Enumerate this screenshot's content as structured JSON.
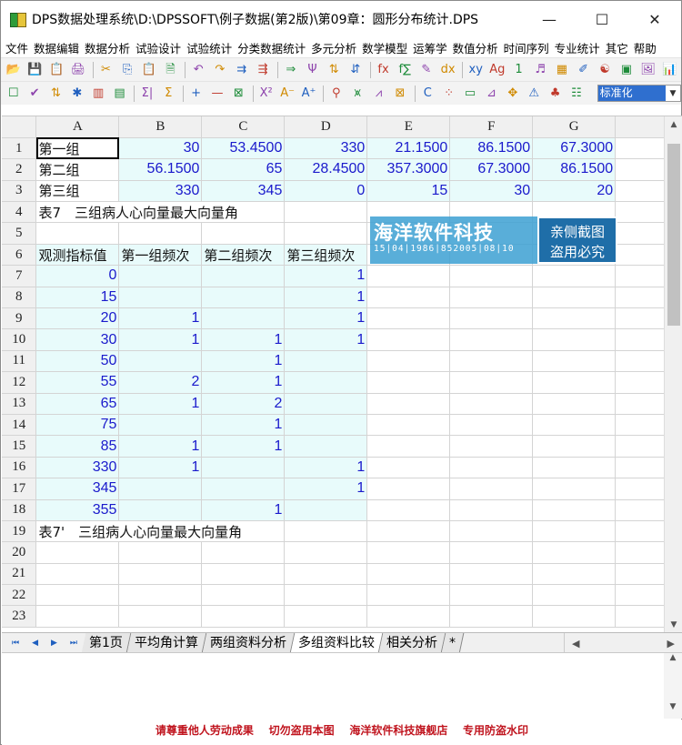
{
  "window": {
    "title": "DPS数据处理系统\\D:\\DPSSOFT\\例子数据(第2版)\\第09章：圆形分布统计.DPS",
    "min": "—",
    "max": "☐",
    "close": "✕"
  },
  "menu": [
    "文件",
    "数据编辑",
    "数据分析",
    "试验设计",
    "试验统计",
    "分类数据统计",
    "多元分析",
    "数学模型",
    "运筹学",
    "数值分析",
    "时间序列",
    "专业统计",
    "其它",
    "帮助"
  ],
  "toolbar1": [
    "📂",
    "💾",
    "📋",
    "🖨",
    "✂",
    "⎘",
    "📋",
    "🗎",
    "↶",
    "↷",
    "⇉",
    "⇶",
    "⇒",
    "Ψ",
    "⇅",
    "⇵",
    "fx",
    "f∑",
    "✎",
    "dx",
    "xy",
    "Ag",
    "1",
    "♬",
    "▦",
    "✐",
    "☯",
    "▣",
    "🖼",
    "📊"
  ],
  "toolbar2": [
    "☐",
    "✔",
    "⇅",
    "✱",
    "▥",
    "▤",
    "Σ|",
    "Σ",
    "+",
    "—",
    "⊠",
    "X²",
    "A⁻",
    "A⁺",
    "⚲",
    "⩙",
    "⩘",
    "⊠",
    "C",
    "⁘",
    "▭",
    "⊿",
    "✥",
    "⚠",
    "♣",
    "☷"
  ],
  "style_select": {
    "value": "标准化",
    "arrow": "▼"
  },
  "columns": [
    "A",
    "B",
    "C",
    "D",
    "E",
    "F",
    "G"
  ],
  "rows": [
    {
      "n": "1",
      "cells": [
        "第一组",
        "30",
        "53.4500",
        "330",
        "21.1500",
        "86.1500",
        "67.3000"
      ]
    },
    {
      "n": "2",
      "cells": [
        "第二组",
        "56.1500",
        "65",
        "28.4500",
        "357.3000",
        "67.3000",
        "86.1500"
      ]
    },
    {
      "n": "3",
      "cells": [
        "第三组",
        "330",
        "345",
        "0",
        "15",
        "30",
        "20"
      ]
    },
    {
      "n": "4",
      "cells": [
        "表7　三组病人心向量最大向量角",
        "",
        "",
        "",
        "",
        "",
        ""
      ]
    },
    {
      "n": "5",
      "cells": [
        "",
        "",
        "",
        "",
        "",
        "",
        ""
      ]
    },
    {
      "n": "6",
      "cells": [
        "观测指标值",
        "第一组频次",
        "第二组频次",
        "第三组频次",
        "",
        "",
        ""
      ]
    },
    {
      "n": "7",
      "cells": [
        "0",
        "",
        "",
        "1",
        "",
        "",
        ""
      ]
    },
    {
      "n": "8",
      "cells": [
        "15",
        "",
        "",
        "1",
        "",
        "",
        ""
      ]
    },
    {
      "n": "9",
      "cells": [
        "20",
        "1",
        "",
        "1",
        "",
        "",
        ""
      ]
    },
    {
      "n": "10",
      "cells": [
        "30",
        "1",
        "1",
        "1",
        "",
        "",
        ""
      ]
    },
    {
      "n": "11",
      "cells": [
        "50",
        "",
        "1",
        "",
        "",
        "",
        ""
      ]
    },
    {
      "n": "12",
      "cells": [
        "55",
        "2",
        "1",
        "",
        "",
        "",
        ""
      ]
    },
    {
      "n": "13",
      "cells": [
        "65",
        "1",
        "2",
        "",
        "",
        "",
        ""
      ]
    },
    {
      "n": "14",
      "cells": [
        "75",
        "",
        "1",
        "",
        "",
        "",
        ""
      ]
    },
    {
      "n": "15",
      "cells": [
        "85",
        "1",
        "1",
        "",
        "",
        "",
        ""
      ]
    },
    {
      "n": "16",
      "cells": [
        "330",
        "1",
        "",
        "1",
        "",
        "",
        ""
      ]
    },
    {
      "n": "17",
      "cells": [
        "345",
        "",
        "",
        "1",
        "",
        "",
        ""
      ]
    },
    {
      "n": "18",
      "cells": [
        "355",
        "",
        "1",
        "",
        "",
        "",
        ""
      ]
    },
    {
      "n": "19",
      "cells": [
        "表7'　三组病人心向量最大向量角",
        "",
        "",
        "",
        "",
        "",
        ""
      ]
    },
    {
      "n": "20",
      "cells": [
        "",
        "",
        "",
        "",
        "",
        "",
        ""
      ]
    },
    {
      "n": "21",
      "cells": [
        "",
        "",
        "",
        "",
        "",
        "",
        ""
      ]
    },
    {
      "n": "22",
      "cells": [
        "",
        "",
        "",
        "",
        "",
        "",
        ""
      ]
    },
    {
      "n": "23",
      "cells": [
        "",
        "",
        "",
        "",
        "",
        "",
        ""
      ]
    }
  ],
  "watermark": {
    "brand": "海洋软件科技",
    "code": "15|04|1986|852005|08|10",
    "line1": "亲侧截图",
    "line2": "盗用必究"
  },
  "sheet_tabs": [
    "第1页",
    "平均角计算",
    "两组资料分析",
    "多组资料比较",
    "相关分析",
    "*"
  ],
  "active_tab": 3,
  "tab_nav": [
    "⏮",
    "◀",
    "▶",
    "⏭"
  ],
  "footer": "请尊重他人劳动成果    切勿盗用本图    海洋软件科技旗舰店    专用防盗水印"
}
